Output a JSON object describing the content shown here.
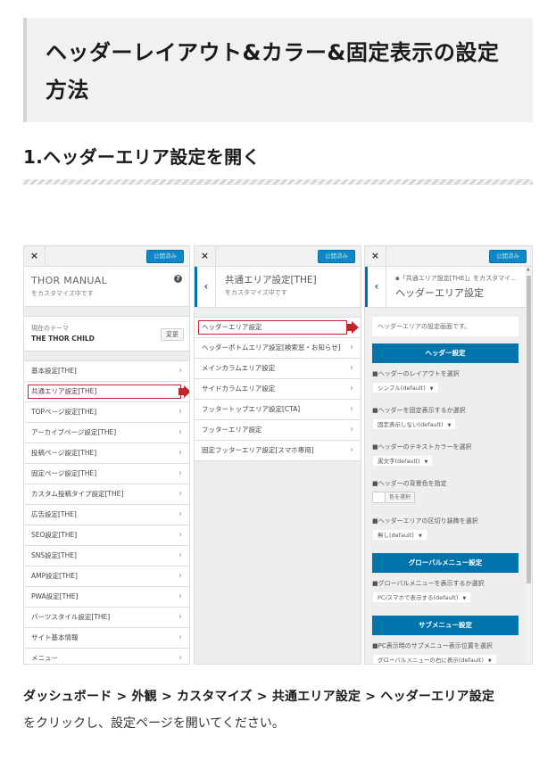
{
  "article": {
    "title": "ヘッダーレイアウト&カラー&固定表示の設定方法",
    "section_heading": "1.ヘッダーエリア設定を開く",
    "instruction_path": "ダッシュボード > 外観 > カスタマイズ > 共通エリア設定 > ヘッダーエリア設定",
    "instruction_text": "をクリックし、設定ページを開いてください。"
  },
  "accent_colors": {
    "primary_blue": "#0073aa",
    "highlight_red": "#c0262d"
  },
  "panel1": {
    "close_icon": "×",
    "publish_label": "公開済み",
    "site_title": "THOR MANUAL",
    "site_sub": "をカスタマイズ中です",
    "help_icon": "?",
    "theme_label": "現在のテーマ",
    "theme_name": "THE THOR CHILD",
    "change_label": "変更",
    "menu_items": [
      {
        "label": "基本設定[THE]"
      },
      {
        "label": "共通エリア設定[THE]"
      },
      {
        "label": "TOPページ設定[THE]"
      },
      {
        "label": "アーカイブページ設定[THE]"
      },
      {
        "label": "投稿ページ設定[THE]"
      },
      {
        "label": "固定ページ設定[THE]"
      },
      {
        "label": "カスタム投稿タイプ設定[THE]"
      },
      {
        "label": "広告設定[THE]"
      },
      {
        "label": "SEO設定[THE]"
      },
      {
        "label": "SNS設定[THE]"
      },
      {
        "label": "AMP設定[THE]"
      },
      {
        "label": "PWA設定[THE]"
      },
      {
        "label": "パーツスタイル設定[THE]"
      },
      {
        "label": "サイト基本情報"
      },
      {
        "label": "メニュー"
      }
    ],
    "chevron": "›"
  },
  "panel2": {
    "close_icon": "×",
    "publish_label": "公開済み",
    "back_icon": "‹",
    "title": "共通エリア設定[THE]",
    "sub": "をカスタマイズ中です",
    "menu_items": [
      {
        "label": "ヘッダーエリア設定"
      },
      {
        "label": "ヘッダーボトムエリア設定[検索窓・お知らせ]"
      },
      {
        "label": "メインカラムエリア設定"
      },
      {
        "label": "サイドカラムエリア設定"
      },
      {
        "label": "フッタートップエリア設定[CTA]"
      },
      {
        "label": "フッターエリア設定"
      },
      {
        "label": "固定フッターエリア設定[スマホ専用]"
      }
    ],
    "chevron": "›"
  },
  "panel3": {
    "close_icon": "×",
    "publish_label": "公開済み",
    "back_icon": "‹",
    "breadcrumb": "▪「共通エリア設定[THE]」をカスタマイ...",
    "title": "ヘッダーエリア設定",
    "description": "ヘッダーエリアの設定画面です。",
    "sections": [
      {
        "title": "ヘッダー設定",
        "fields": [
          {
            "label": "■ヘッダーのレイアウトを選択",
            "type": "select",
            "value": "シンプル(default)"
          },
          {
            "label": "■ヘッダーを固定表示するか選択",
            "type": "select",
            "value": "固定表示しない(default)"
          },
          {
            "label": "■ヘッダーのテキストカラーを選択",
            "type": "select",
            "value": "黒文字(default)"
          },
          {
            "label": "■ヘッダーの背景色を指定",
            "type": "color",
            "value": "色を選択"
          },
          {
            "label": "■ヘッダーエリアの区切り装飾を選択",
            "type": "select",
            "value": "無し(default)"
          }
        ]
      },
      {
        "title": "グローバルメニュー設定",
        "fields": [
          {
            "label": "■グローバルメニューを表示するか選択",
            "type": "select",
            "value": "PC/スマホで表示する(default)"
          }
        ]
      },
      {
        "title": "サブメニュー設定",
        "fields": [
          {
            "label": "■PC表示時のサブメニュー表示位置を選択",
            "type": "select",
            "value": "グローバルメニューの右に表示(default)"
          }
        ]
      }
    ],
    "caret": "▼",
    "scroll_up": "▲"
  }
}
